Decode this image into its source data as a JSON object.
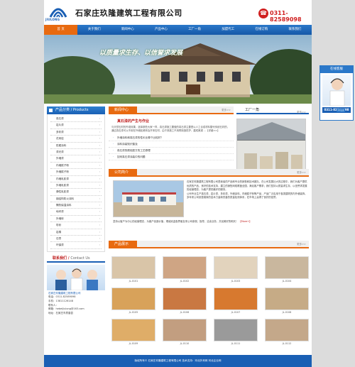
{
  "header": {
    "logo_text": "JIULONG",
    "company_name": "石家庄玖隆建筑工程有限公司",
    "phone": "0311-82589098"
  },
  "nav": [
    "首 页",
    "关于我们",
    "新闻中心",
    "产品中心",
    "工厂一角",
    "加盟代工",
    "在线订购",
    "联系我们"
  ],
  "banner": {
    "slogan": "以质量求生存、以信誉求发展"
  },
  "products": {
    "title": "产品分类 / Products",
    "items": [
      "真石漆",
      "岩片漆",
      "多彩漆",
      "花岗岩",
      "防腐涂料",
      "漆光漆",
      "外墙漆",
      "内墙腻子粉",
      "外墙腻子粉",
      "内墙乳胶漆",
      "外墙乳胶漆",
      "弹性乳胶漆",
      "钢结构防火涂料",
      "隔热保温涂料",
      "地坪漆",
      "外墙砖",
      "彩砂",
      "岩棉",
      "石膏",
      "环保漆"
    ]
  },
  "contact": {
    "title": "联系我们",
    "title_en": "Contact Us",
    "company": "石家庄玖隆建筑工程有限公司",
    "lines": [
      "电话：0311-82589098",
      "手机：13811126148",
      "联系人：",
      "邮箱：hebeijiulong@163.com",
      "地址：石家庄市质普县"
    ]
  },
  "news": {
    "title": "新闻中心",
    "more": "更多>>",
    "headline": "真石漆的产生与作业",
    "summary": "与天然石材的外观效果，选择那些大家一样，真石漆施工要做的真石漆主要是以人工合成材料替代传统石材的，通过真石漆可以不用在外墙贴瓷砖及开采石材，由于其施工不用再制造防护，建成美观 ...【详细>>】",
    "items": [
      "外墙涂料和真石漆的性价比哪个比较好？",
      "涂料涂装知识普及",
      "真石漆的颜色配方的工艺原理",
      "如何真石漆涂装中的问题"
    ]
  },
  "works": {
    "title": "工厂一角",
    "more": "更多>>"
  },
  "about": {
    "title": "公司简介",
    "more": "更多>>",
    "p1": "石家庄玖隆建筑工程有限公司是我省的产品和专业的销售和技术团队，在公司发展壮大的过程中，我们为客户提供优质的产品、良好的技术支持，建立的销售网络覆盖全国，满足客户需求；我们坚持以质量求生存、以信誉求发展的经营理念，为客户提供最好的服务。",
    "p2": "公司专业生产真石漆、岩片漆、多彩漆、外墙涂料、内墙腻子粉等产品，产品广泛应用于各类建筑的内外墙装饰。多年来公司依靠雄厚的技术力量和完善的质量检测体系，在市场上赢得了良好的信誉。",
    "p3": "坚持以客户为中心的经营理念，为客户创造价值，竭诚欢迎各界朋友来公司参观、指导、洽谈业务，共创美好的明天！",
    "more_link": "【More+】"
  },
  "show": {
    "title": "产品展示",
    "more": "更多>>",
    "items": [
      {
        "caption": "JL-0101"
      },
      {
        "caption": "JL-0102"
      },
      {
        "caption": "JL-0103"
      },
      {
        "caption": "JL-0104"
      },
      {
        "caption": "JL-0105"
      },
      {
        "caption": "JL-0106"
      },
      {
        "caption": "JL-0107"
      },
      {
        "caption": "JL-0108"
      },
      {
        "caption": "JL-0109"
      },
      {
        "caption": "JL-0110"
      },
      {
        "caption": "JL-0111"
      },
      {
        "caption": "JL-0112"
      }
    ]
  },
  "footer": {
    "text": "版权所有© 石家庄玖隆建筑工程有限公司   技术支持：河北外来网   河北企业网"
  },
  "float": {
    "title": "在线客服",
    "qq_label": "QQ交谈",
    "phone": "0311-82589098"
  },
  "colors": {
    "brand_blue": "#1a5fb4",
    "accent_orange": "#e86a10",
    "phone_red": "#d02020",
    "swatches": [
      "#d9c5a8",
      "#cfa584",
      "#e2d3bd",
      "#c9b79e",
      "#d8a25a",
      "#c97842",
      "#d7792f",
      "#c6ab86",
      "#dfad68",
      "#c29e80",
      "#9a9a9a",
      "#c4a88a"
    ]
  }
}
